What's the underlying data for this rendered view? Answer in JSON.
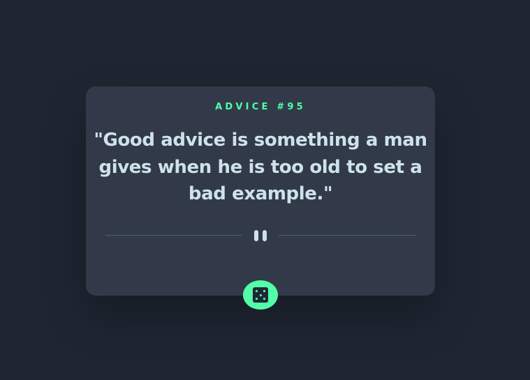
{
  "card": {
    "advice_label": "ADVICE #95",
    "quote": "\"Good advice is something a man gives when he is too old to set a bad example.\""
  },
  "icons": {
    "divider_center": "pause-icon",
    "generate_button": "dice-icon"
  },
  "colors": {
    "background": "#1f2632",
    "card": "#323a49",
    "accent": "#52ffa8",
    "text": "#cee3e9",
    "divider": "#4f5d74"
  }
}
